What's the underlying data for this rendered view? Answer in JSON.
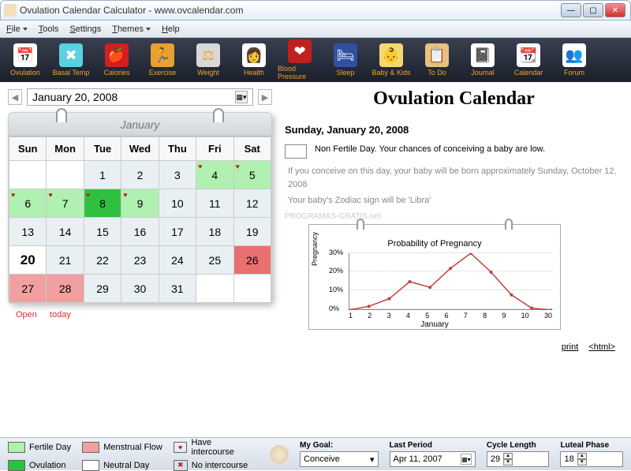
{
  "window": {
    "title": "Ovulation Calendar Calculator - www.ovcalendar.com"
  },
  "menu": [
    "File",
    "Tools",
    "Settings",
    "Themes",
    "Help"
  ],
  "menu_dropdowns": [
    true,
    false,
    false,
    true,
    false
  ],
  "toolbar": [
    {
      "label": "Ovulation",
      "icon": "📅"
    },
    {
      "label": "Basal Temp",
      "icon": "✖"
    },
    {
      "label": "Calories",
      "icon": "🍎"
    },
    {
      "label": "Exercise",
      "icon": "🏃"
    },
    {
      "label": "Weight",
      "icon": "⚖"
    },
    {
      "label": "Health",
      "icon": "👩"
    },
    {
      "label": "Blood Pressure",
      "icon": "❤"
    },
    {
      "label": "Sleep",
      "icon": "🛏"
    },
    {
      "label": "Baby & Kids",
      "icon": "👶"
    },
    {
      "label": "To Do",
      "icon": "📋"
    },
    {
      "label": "Journal",
      "icon": "📓"
    },
    {
      "label": "Calendar",
      "icon": "📆"
    },
    {
      "label": "Forum",
      "icon": "👥"
    }
  ],
  "datenav": {
    "date": "January   20, 2008"
  },
  "calendar": {
    "month_label": "January",
    "dow": [
      "Sun",
      "Mon",
      "Tue",
      "Wed",
      "Thu",
      "Fri",
      "Sat"
    ],
    "cells": [
      [
        {
          "v": "",
          "c": ""
        },
        {
          "v": "",
          "c": ""
        },
        {
          "v": "1",
          "c": "neutral"
        },
        {
          "v": "2",
          "c": "neutral"
        },
        {
          "v": "3",
          "c": "neutral"
        },
        {
          "v": "4",
          "c": "fertile",
          "h": true
        },
        {
          "v": "5",
          "c": "fertile",
          "h": true
        }
      ],
      [
        {
          "v": "6",
          "c": "fertile",
          "h": true
        },
        {
          "v": "7",
          "c": "fertile",
          "h": true
        },
        {
          "v": "8",
          "c": "ovul",
          "h": true
        },
        {
          "v": "9",
          "c": "fertile",
          "h": true
        },
        {
          "v": "10",
          "c": "neutral"
        },
        {
          "v": "11",
          "c": "neutral"
        },
        {
          "v": "12",
          "c": "neutral"
        }
      ],
      [
        {
          "v": "13",
          "c": "neutral"
        },
        {
          "v": "14",
          "c": "neutral"
        },
        {
          "v": "15",
          "c": "neutral"
        },
        {
          "v": "16",
          "c": "neutral"
        },
        {
          "v": "17",
          "c": "neutral"
        },
        {
          "v": "18",
          "c": "neutral"
        },
        {
          "v": "19",
          "c": "neutral"
        }
      ],
      [
        {
          "v": "20",
          "c": "",
          "today": true
        },
        {
          "v": "21",
          "c": "neutral"
        },
        {
          "v": "22",
          "c": "neutral"
        },
        {
          "v": "23",
          "c": "neutral"
        },
        {
          "v": "24",
          "c": "neutral"
        },
        {
          "v": "25",
          "c": "neutral"
        },
        {
          "v": "26",
          "c": "flowdeep"
        }
      ],
      [
        {
          "v": "27",
          "c": "flow"
        },
        {
          "v": "28",
          "c": "flow"
        },
        {
          "v": "29",
          "c": "neutral"
        },
        {
          "v": "30",
          "c": "neutral"
        },
        {
          "v": "31",
          "c": "neutral"
        },
        {
          "v": "",
          "c": ""
        },
        {
          "v": "",
          "c": ""
        }
      ]
    ]
  },
  "callinks": {
    "open": "Open",
    "today": "today"
  },
  "right": {
    "title": "Ovulation Calendar",
    "date": "Sunday, January 20, 2008",
    "status": "Non Fertile Day. Your chances of conceiving a baby are low.",
    "conceive": "If you conceive on this day, your baby will be born approximately Sunday, October 12, 2008",
    "zodiac": "Your baby's Zodiac sign will be 'Libra'",
    "watermark": "PROGRAMAS-GRATIS.net",
    "print": "print",
    "html": "<html>"
  },
  "chart_data": {
    "type": "line",
    "title": "Probability of Pregnancy",
    "xlabel": "January",
    "ylabel": "Pregnancy",
    "ylim": [
      0,
      30
    ],
    "yticks": [
      "0%",
      "10%",
      "20%",
      "30%"
    ],
    "x": [
      1,
      2,
      3,
      4,
      5,
      6,
      7,
      8,
      9,
      10,
      30
    ],
    "values": [
      0,
      2,
      6,
      15,
      12,
      22,
      30,
      20,
      8,
      1,
      0
    ]
  },
  "legend": {
    "fertile": "Fertile Day",
    "flow": "Menstrual Flow",
    "have": "Have intercourse",
    "ovul": "Ovulation",
    "neutral": "Neutral Day",
    "no": "No intercourse"
  },
  "goals": {
    "goal_label": "My Goal:",
    "goal_value": "Conceive",
    "last_label": "Last Period",
    "last_value": "Apr 11, 2007",
    "cycle_label": "Cycle Length",
    "cycle_value": "29",
    "luteal_label": "Luteal Phase",
    "luteal_value": "18"
  }
}
